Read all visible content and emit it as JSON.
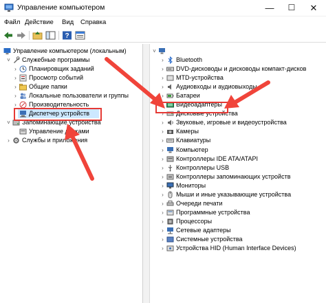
{
  "window": {
    "title": "Управление компьютером",
    "minimize": "—",
    "maximize": "☐",
    "close": "✕"
  },
  "menu": [
    "Файл",
    "Действие",
    "Вид",
    "Справка"
  ],
  "left_tree": [
    {
      "label": "Управление компьютером (локальным)",
      "expander": "",
      "icon": "computer-management-icon"
    },
    {
      "label": "Служебные программы",
      "expander": "v",
      "icon": "tools-icon"
    },
    {
      "label": "Планировщик заданий",
      "expander": ">",
      "icon": "clock-icon"
    },
    {
      "label": "Просмотр событий",
      "expander": ">",
      "icon": "event-viewer-icon"
    },
    {
      "label": "Общие папки",
      "expander": ">",
      "icon": "shared-folder-icon"
    },
    {
      "label": "Локальные пользователи и группы",
      "expander": ">",
      "icon": "users-icon"
    },
    {
      "label": "Производительность",
      "expander": ">",
      "icon": "performance-icon"
    },
    {
      "label": "Диспетчер устройств",
      "expander": "",
      "icon": "device-manager-icon"
    },
    {
      "label": "Запоминающие устройства",
      "expander": "v",
      "icon": "storage-icon"
    },
    {
      "label": "Управление дисками",
      "expander": "",
      "icon": "disk-icon"
    },
    {
      "label": "Службы и приложения",
      "expander": ">",
      "icon": "services-icon"
    }
  ],
  "right_tree": {
    "root_label": "",
    "items": [
      {
        "label": "Bluetooth",
        "icon": "bluetooth-icon"
      },
      {
        "label": "DVD-дисководы и дисководы компакт-дисков",
        "icon": "dvd-icon"
      },
      {
        "label": "MTD-устройства",
        "icon": "mtd-icon"
      },
      {
        "label": "Аудиовходы и аудиовыходы",
        "icon": "audio-icon"
      },
      {
        "label": "Батареи",
        "icon": "battery-icon"
      },
      {
        "label": "Видеоадаптеры",
        "icon": "display-adapter-icon"
      },
      {
        "label": "Дисковые устройства",
        "icon": "disk-drive-icon"
      },
      {
        "label": "Звуковые, игровые и видеоустройства",
        "icon": "sound-icon"
      },
      {
        "label": "Камеры",
        "icon": "camera-icon"
      },
      {
        "label": "Клавиатуры",
        "icon": "keyboard-icon"
      },
      {
        "label": "Компьютер",
        "icon": "computer-icon"
      },
      {
        "label": "Контроллеры IDE ATA/ATAPI",
        "icon": "ide-icon"
      },
      {
        "label": "Контроллеры USB",
        "icon": "usb-icon"
      },
      {
        "label": "Контроллеры запоминающих устройств",
        "icon": "storage-controller-icon"
      },
      {
        "label": "Мониторы",
        "icon": "monitor-icon"
      },
      {
        "label": "Мыши и иные указывающие устройства",
        "icon": "mouse-icon"
      },
      {
        "label": "Очереди печати",
        "icon": "print-queue-icon"
      },
      {
        "label": "Программные устройства",
        "icon": "software-device-icon"
      },
      {
        "label": "Процессоры",
        "icon": "processor-icon"
      },
      {
        "label": "Сетевые адаптеры",
        "icon": "network-icon"
      },
      {
        "label": "Системные устройства",
        "icon": "system-device-icon"
      },
      {
        "label": "Устройства HID (Human Interface Devices)",
        "icon": "hid-icon"
      }
    ]
  },
  "colors": {
    "highlight_red": "#e53935",
    "arrow_red": "#f0443a",
    "selection_blue": "#cce8ff"
  }
}
